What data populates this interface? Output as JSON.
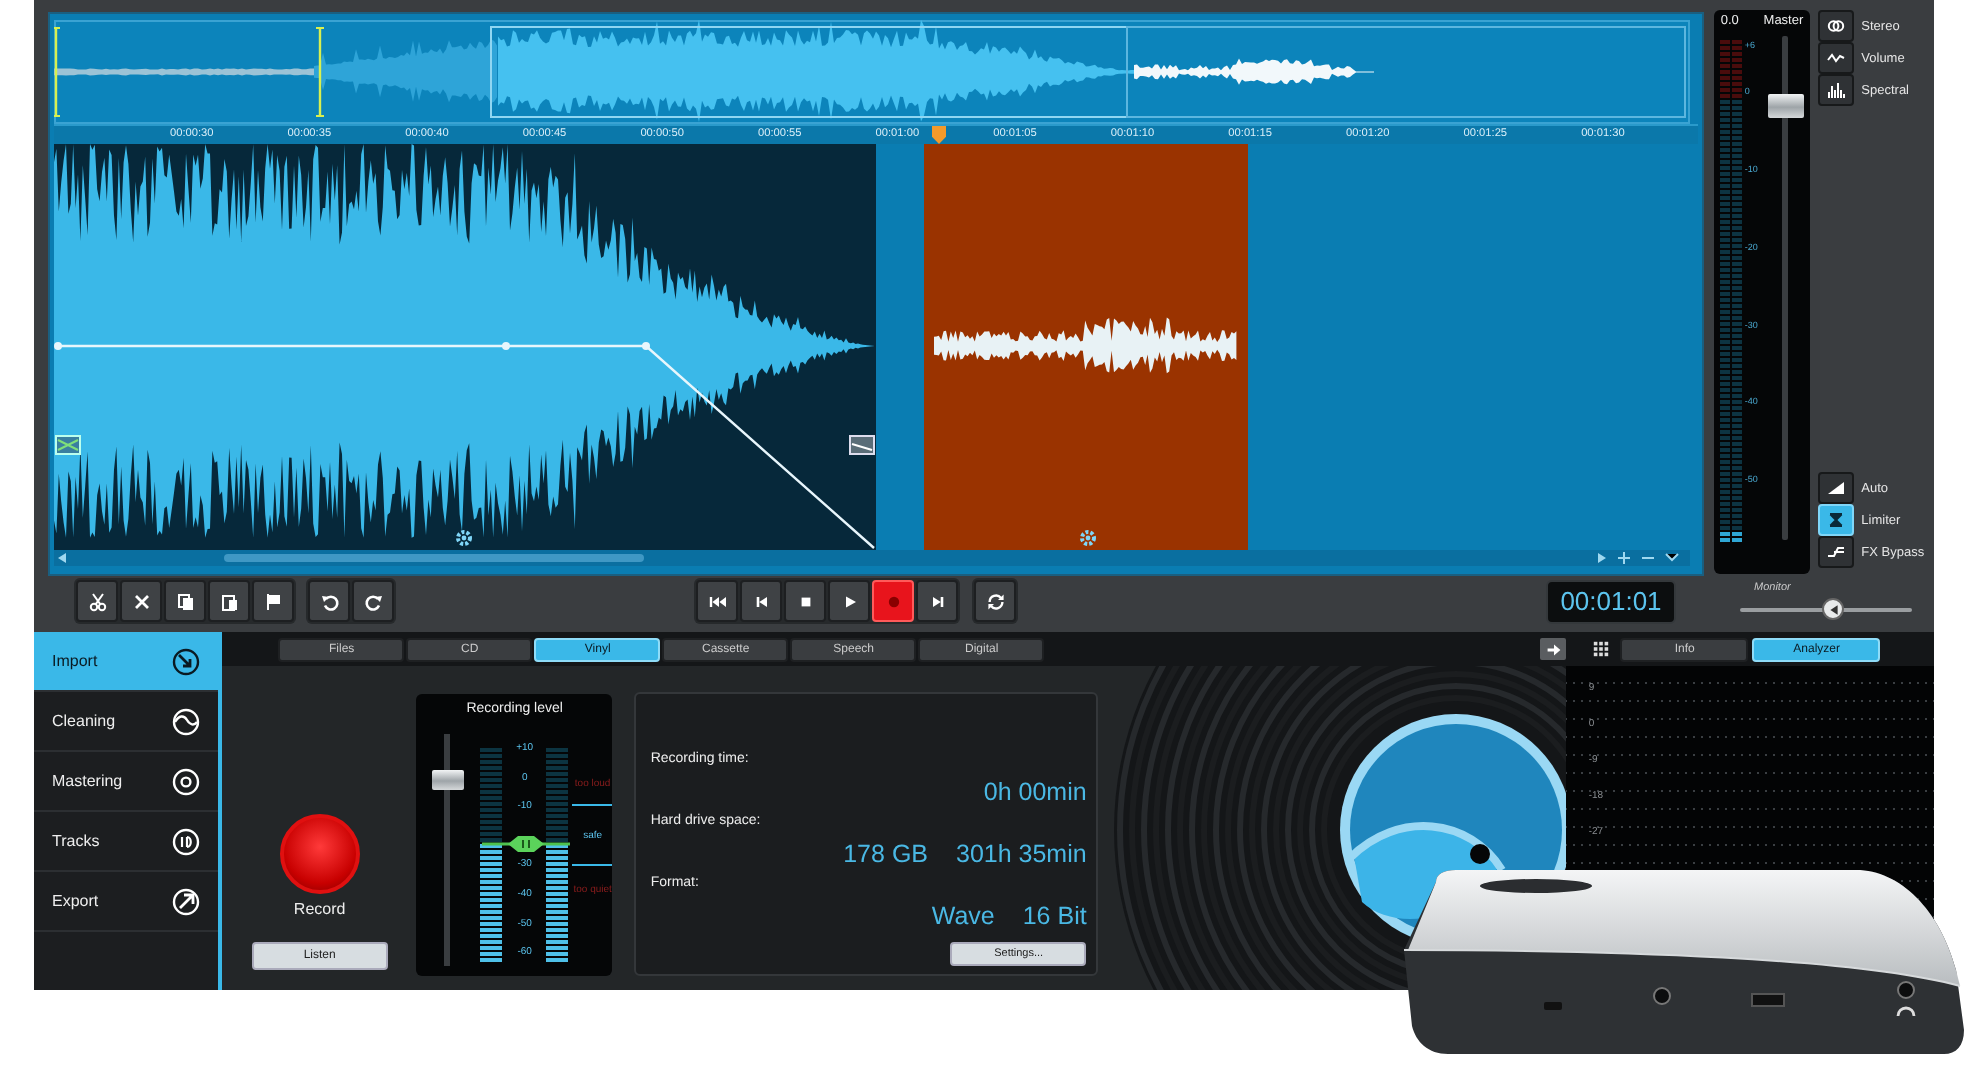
{
  "timeline": {
    "ticks": [
      "00:00:30",
      "00:00:35",
      "00:00:40",
      "00:00:45",
      "00:00:50",
      "00:00:55",
      "00:01:00",
      "00:01:05",
      "00:01:10",
      "00:01:15",
      "00:01:20",
      "00:01:25",
      "00:01:30"
    ]
  },
  "clips": [
    {
      "selected": false
    },
    {
      "selected": true
    }
  ],
  "master": {
    "peak": "0.0",
    "label": "Master",
    "level": 0.88,
    "scale": [
      "+6",
      "0",
      "-10",
      "-20",
      "-30",
      "-40",
      "-50"
    ]
  },
  "view_buttons": [
    {
      "label": "Stereo"
    },
    {
      "label": "Volume"
    },
    {
      "label": "Spectral"
    }
  ],
  "mode_buttons": [
    {
      "label": "Auto",
      "on": false
    },
    {
      "label": "Limiter",
      "on": true
    },
    {
      "label": "FX Bypass",
      "on": false
    }
  ],
  "transport": {
    "recording": true
  },
  "time_display": "00:01:01",
  "monitor": {
    "label": "Monitor",
    "level": 0.55
  },
  "sidebar": [
    {
      "label": "Import",
      "selected": true
    },
    {
      "label": "Cleaning",
      "selected": false
    },
    {
      "label": "Mastering",
      "selected": false
    },
    {
      "label": "Tracks",
      "selected": false
    },
    {
      "label": "Export",
      "selected": false
    }
  ],
  "source_tabs": [
    {
      "label": "Files",
      "selected": false
    },
    {
      "label": "CD",
      "selected": false
    },
    {
      "label": "Vinyl",
      "selected": true
    },
    {
      "label": "Cassette",
      "selected": false
    },
    {
      "label": "Speech",
      "selected": false
    },
    {
      "label": "Digital",
      "selected": false
    }
  ],
  "record": {
    "label": "Record",
    "listen": "Listen"
  },
  "recording_level": {
    "title": "Recording level",
    "level": 0.83,
    "meters": [
      {
        "level": 0.56
      },
      {
        "level": 0.56
      }
    ],
    "scale": [
      "+10",
      "0",
      "-10",
      "-30",
      "-40",
      "-50",
      "-60"
    ],
    "zones": [
      {
        "label": "too loud",
        "kind": "warn"
      },
      {
        "label": "safe",
        "kind": "ok"
      },
      {
        "label": "too quiet",
        "kind": "warn"
      }
    ]
  },
  "info": {
    "rows": [
      {
        "label": "Recording time:",
        "values": [
          "0h 00min"
        ]
      },
      {
        "label": "Hard drive space:",
        "values": [
          "178 GB",
          "301h 35min"
        ]
      },
      {
        "label": "Format:",
        "values": [
          "Wave",
          "16 Bit"
        ]
      }
    ],
    "settings": "Settings..."
  },
  "right_tabs": [
    {
      "label": "Info",
      "selected": false
    },
    {
      "label": "Analyzer",
      "selected": true
    }
  ],
  "analyzer": {
    "scale": [
      "9",
      "0",
      "-9",
      "-18",
      "-27"
    ]
  }
}
